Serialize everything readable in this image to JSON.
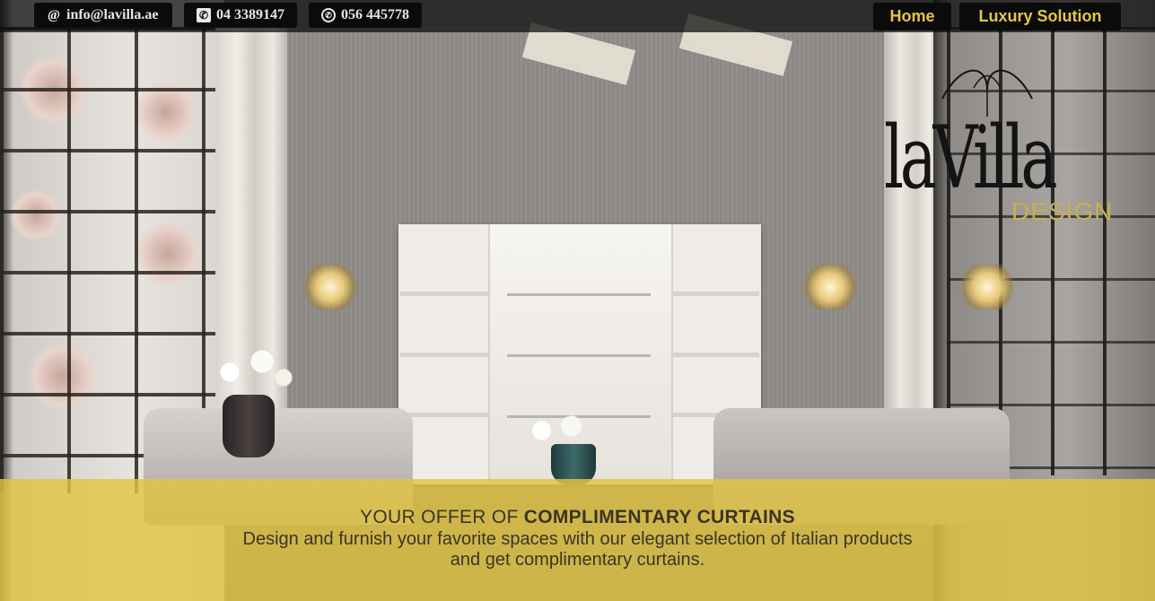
{
  "contact": {
    "email": "info@lavilla.ae",
    "phone": "04 3389147",
    "whatsapp": "056 445778",
    "icons": [
      "at-icon",
      "phone-icon",
      "whatsapp-icon"
    ]
  },
  "nav": {
    "items": [
      {
        "label": "Home"
      },
      {
        "label": "Luxury Solution"
      }
    ]
  },
  "logo": {
    "word": "laVilla",
    "subtitle": "DESIGN"
  },
  "promo": {
    "title_prefix": "YOUR OFFER OF ",
    "title_strong": "COMPLIMENTARY CURTAINS",
    "text": "Design and furnish your favorite spaces with our elegant selection of Italian products and get complimentary curtains."
  },
  "colors": {
    "accent": "#e2c64a",
    "topbar": "#0b0b0b",
    "promo_band": "#e2c442",
    "logo_sub": "#c9b04a"
  }
}
